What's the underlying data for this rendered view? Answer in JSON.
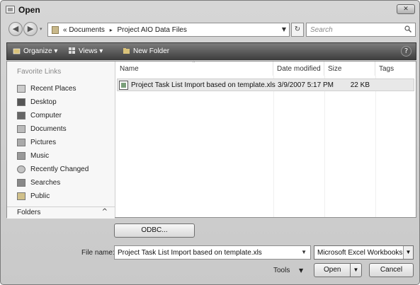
{
  "window": {
    "title": "Open",
    "close_label": "✕"
  },
  "address": {
    "segments": [
      "« Documents",
      "Project AIO Data Files"
    ],
    "separator": "▸",
    "search_placeholder": "Search"
  },
  "toolbar": {
    "organize": "Organize ▾",
    "views": "Views ▾",
    "new_folder": "New Folder",
    "help": "?"
  },
  "nav": {
    "header": "Favorite Links",
    "items": [
      {
        "label": "Recent Places",
        "icon": "recent-places-icon"
      },
      {
        "label": "Desktop",
        "icon": "desktop-icon"
      },
      {
        "label": "Computer",
        "icon": "computer-icon"
      },
      {
        "label": "Documents",
        "icon": "documents-icon"
      },
      {
        "label": "Pictures",
        "icon": "pictures-icon"
      },
      {
        "label": "Music",
        "icon": "music-icon"
      },
      {
        "label": "Recently Changed",
        "icon": "recently-changed-icon"
      },
      {
        "label": "Searches",
        "icon": "searches-icon"
      },
      {
        "label": "Public",
        "icon": "public-icon"
      }
    ],
    "folders_label": "Folders",
    "folders_chevron": "^"
  },
  "files": {
    "columns": [
      "Name",
      "Date modified",
      "Size",
      "Tags"
    ],
    "rows": [
      {
        "name": "Project Task List Import based on template.xls",
        "date": "3/9/2007 5:17 PM",
        "size": "22 KB",
        "tags": ""
      }
    ]
  },
  "footer": {
    "odbc_label": "ODBC...",
    "file_name_label": "File name:",
    "file_name_value": "Project Task List Import based on template.xls",
    "file_type": "Microsoft Excel Workbooks (",
    "tools_label": "Tools",
    "open_label": "Open",
    "cancel_label": "Cancel"
  }
}
